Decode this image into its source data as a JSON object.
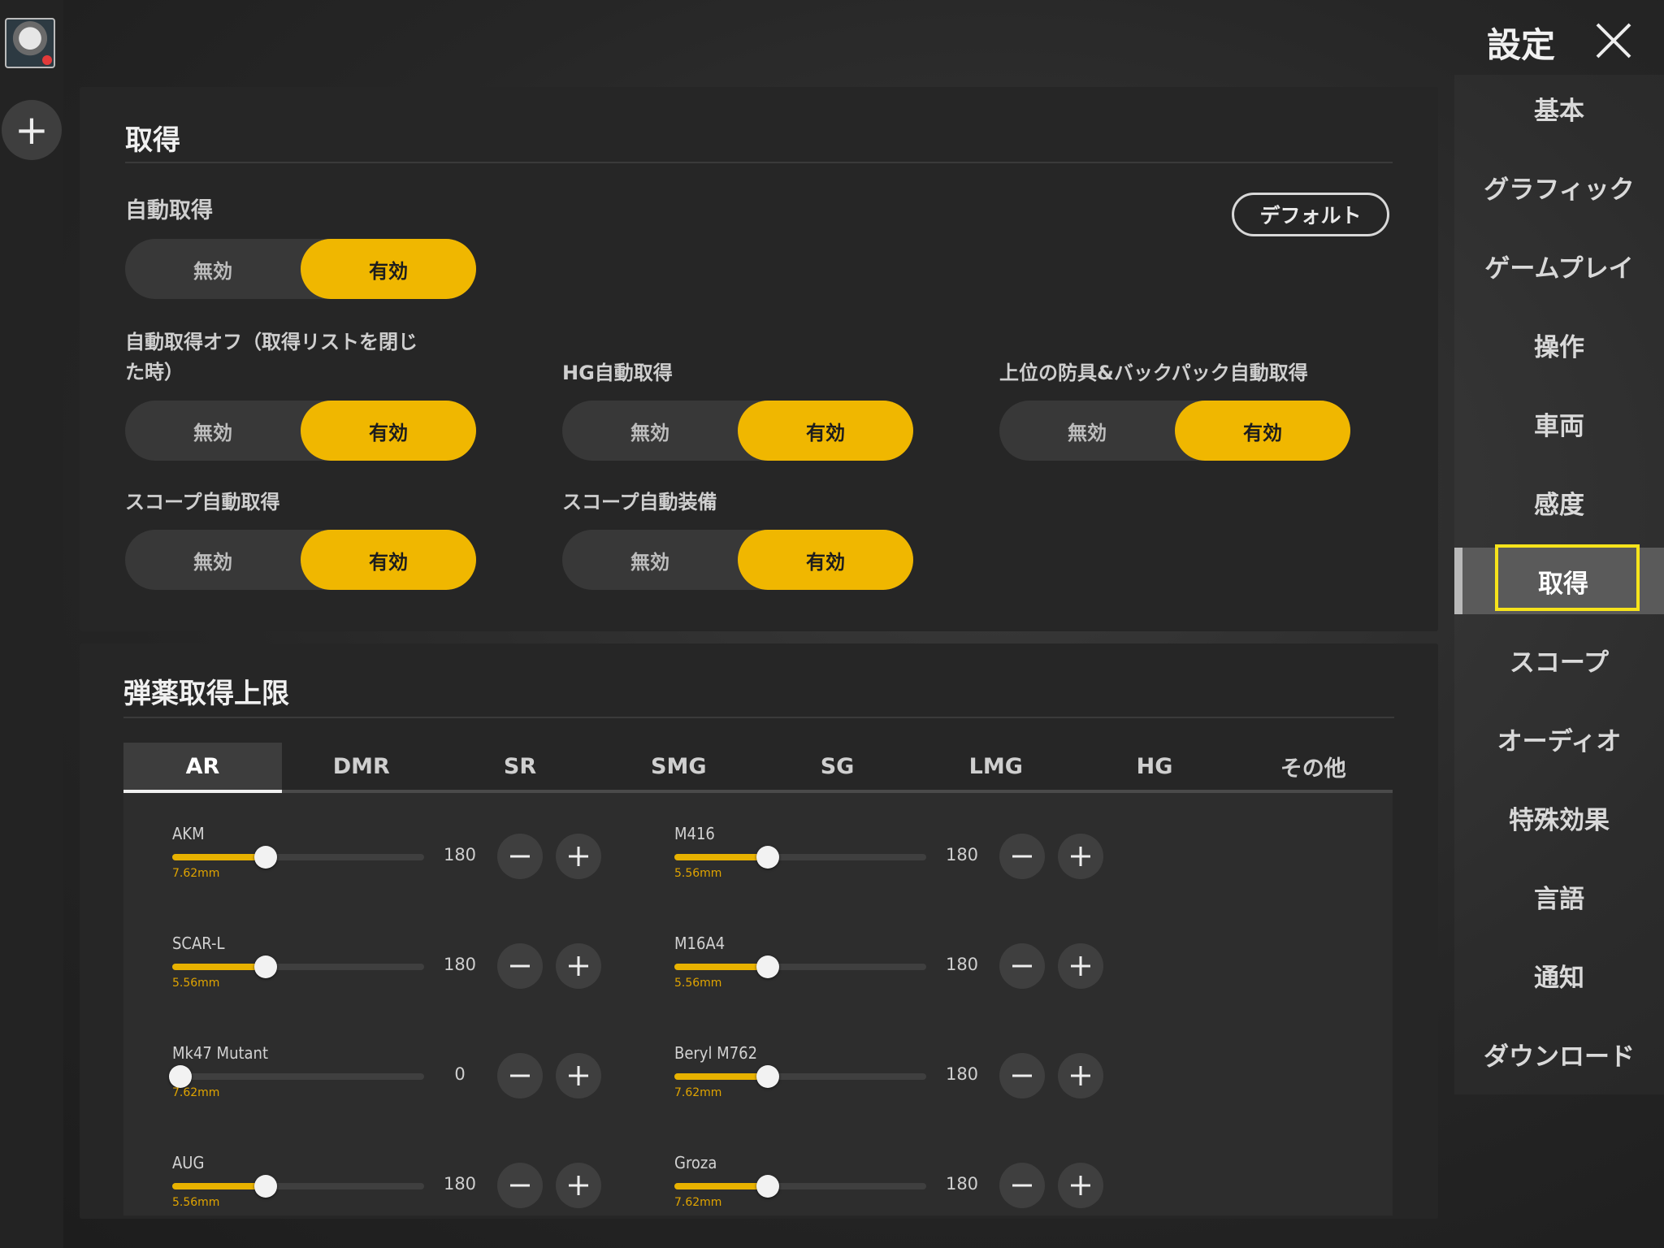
{
  "header": {
    "title": "設定"
  },
  "nav": [
    "基本",
    "グラフィック",
    "ゲームプレイ",
    "操作",
    "車両",
    "感度",
    "取得",
    "スコープ",
    "オーディオ",
    "特殊効果",
    "言語",
    "通知",
    "ダウンロード"
  ],
  "nav_active": "取得",
  "pickup": {
    "title": "取得",
    "default_label": "デフォルト",
    "off_label": "無効",
    "on_label": "有効",
    "auto_pickup": "自動取得",
    "auto_off_line1": "自動取得オフ（取得リストを閉じ",
    "auto_off_line2": "た時）",
    "hg_auto": "HG自動取得",
    "armor_auto": "上位の防具&バックパック自動取得",
    "scope_auto_pickup": "スコープ自動取得",
    "scope_auto_equip": "スコープ自動装備"
  },
  "ammo": {
    "title": "弾薬取得上限",
    "tabs": [
      "AR",
      "DMR",
      "SR",
      "SMG",
      "SG",
      "LMG",
      "HG",
      "その他"
    ],
    "active_tab": "AR",
    "weapons": [
      {
        "name": "AKM",
        "caliber": "7.62mm",
        "value": 180
      },
      {
        "name": "M416",
        "caliber": "5.56mm",
        "value": 180
      },
      {
        "name": "SCAR-L",
        "caliber": "5.56mm",
        "value": 180
      },
      {
        "name": "M16A4",
        "caliber": "5.56mm",
        "value": 180
      },
      {
        "name": "Mk47 Mutant",
        "caliber": "7.62mm",
        "value": 0
      },
      {
        "name": "Beryl M762",
        "caliber": "7.62mm",
        "value": 180
      },
      {
        "name": "AUG",
        "caliber": "5.56mm",
        "value": 180
      },
      {
        "name": "Groza",
        "caliber": "7.62mm",
        "value": 180
      }
    ],
    "slider_fraction_at_180": 0.37
  }
}
